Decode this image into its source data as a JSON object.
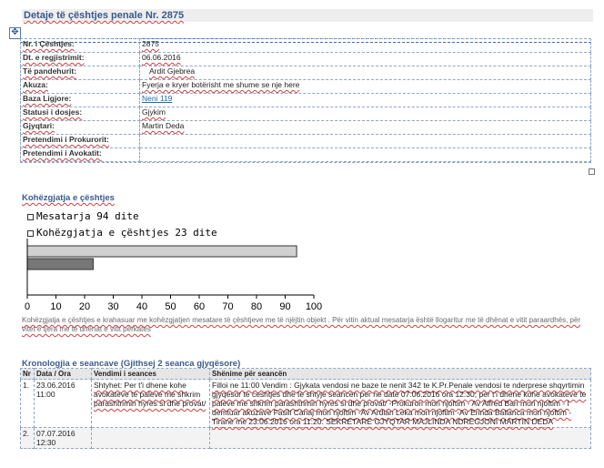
{
  "page": {
    "title": "Detaje të çështjes penale  Nr. 2875"
  },
  "details": {
    "rows": [
      {
        "label": "Nr. i Çështjes:",
        "value": "2875"
      },
      {
        "label": "Dt. e regjistrimit:",
        "value": "06.06.2016"
      },
      {
        "label": "Të pandehurit:",
        "value": "Ardit Gjebrea"
      },
      {
        "label": "Akuza:",
        "value": "Fyerja e kryer botërisht me shume se nje here"
      },
      {
        "label": "Baza Ligjore:",
        "value": "Neni 119",
        "is_link": true
      },
      {
        "label": "Statusi i dosjes:",
        "value": "Gjykim"
      },
      {
        "label": "Gjyqtari:",
        "value": "Martin Deda"
      },
      {
        "label": "Pretendimi i Prokurorit:",
        "value": ""
      },
      {
        "label": "Pretendimi i Avokatit:",
        "value": ""
      }
    ]
  },
  "duration": {
    "heading": "Kohëzgjatja e çështjes",
    "note": "Kohëzgjatja e çështjes e krahasuar me kohëzgjatjen mesatare të çështjeve me të njëjtin objekt . Për vitin aktual mesatarja është llogaritur me të dhënat e vitit paraardhës, për vitet e tjera me të dhënat e vitit përkatës"
  },
  "chart_data": {
    "type": "bar",
    "orientation": "horizontal",
    "series": [
      {
        "name": "Mesatarja 94 dite",
        "value": 94,
        "color": "#d0d0d0"
      },
      {
        "name": "Kohëzgjatja e çështjes 23 dite",
        "value": 23,
        "color": "#777777"
      }
    ],
    "xlim": [
      0,
      100
    ],
    "ticks": [
      "0",
      "10",
      "20",
      "30",
      "40",
      "50",
      "60",
      "70",
      "80",
      "90",
      "100"
    ],
    "grid": false,
    "legend_position": "top-left"
  },
  "chronology": {
    "heading": "Kronologjia e seancave  (Gjithsej 2 seanca gjyqësore)",
    "columns": [
      "Nr",
      "Data / Ora",
      "Vendimi i seances",
      "Shënime për seancën"
    ],
    "rows": [
      {
        "nr": "1.",
        "date": "23.06.2016",
        "time": "11:00",
        "decision": "Shtyhet: Per t'i dhene kohe avokateve te paleve me shkrim parashtrimin hyres si dhe provat/",
        "notes": "Filloi ne 11:00 Vendim : Gjykata vendosi ne baze te nenit 342 te K.Pr.Penale vendosi te nderprese shqyrtimin gjyqesor te ceshtjes dhe te shtyje seancen per ne date 07.06.2016 ora 12:30; per t'i dhene kohe avokateve te paleve me shkrim parashtrimin hyres si dhe provat/ -Prokurori mori njoftim - Av Alfred Bari mori njoftim - I demtuar akuzave Fasili Canaj mori njoftim -Av Ardian Leka mori njoftim -Av Erinda Ballanca mori njoftim - Tirane me 23.06.2016 ora 11:20. SEKRETARE GJYQTAR MAJLINDA NDREGJONI MARTIN DEDA"
      },
      {
        "nr": "2.",
        "date": "07.07.2016",
        "time": "12:30",
        "decision": "",
        "notes": ""
      }
    ]
  }
}
